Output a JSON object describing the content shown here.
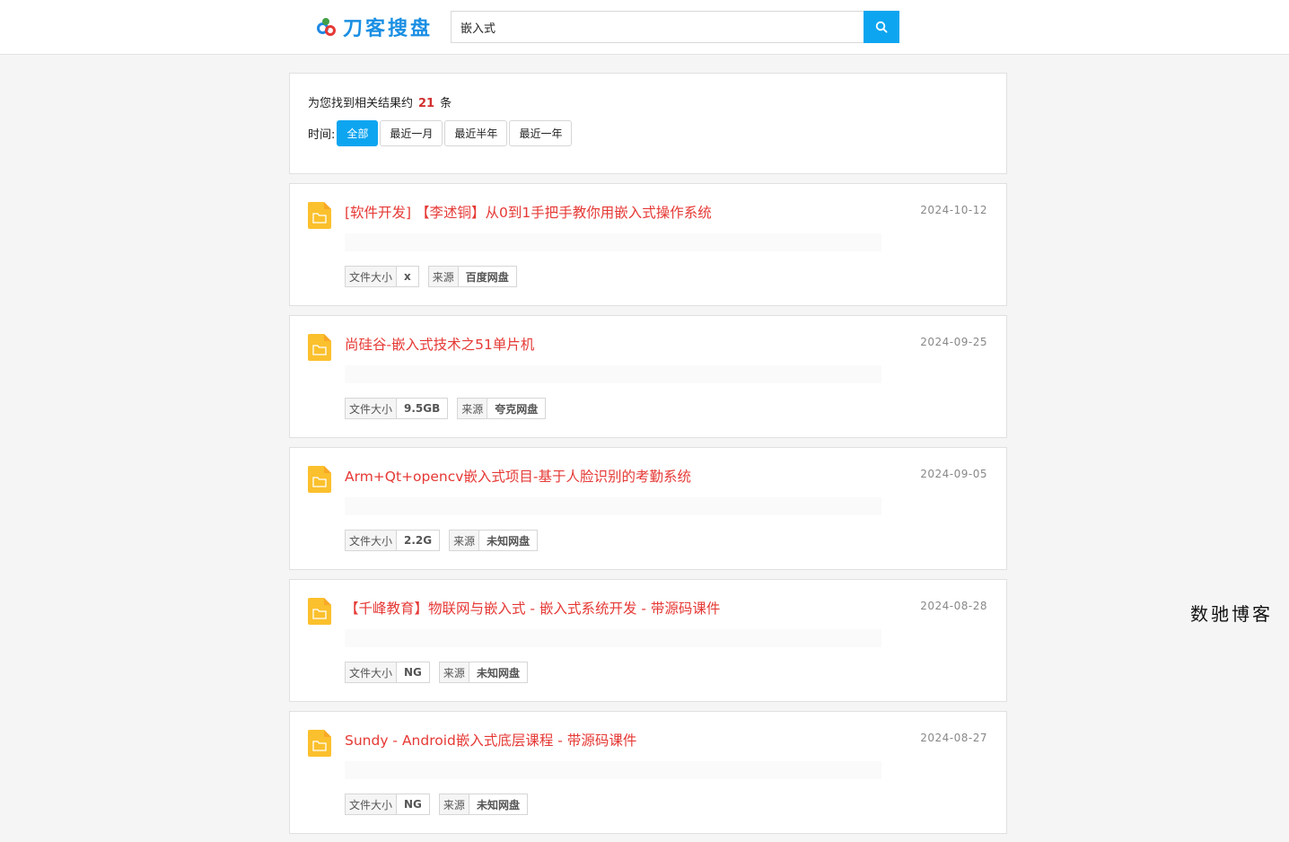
{
  "brand": {
    "name": "刀客搜盘"
  },
  "search": {
    "value": "嵌入式"
  },
  "summary": {
    "prefix": "为您找到相关结果约",
    "count": "21",
    "suffix": "条"
  },
  "time_filter": {
    "label": "时间:",
    "options": [
      "全部",
      "最近一月",
      "最近半年",
      "最近一年"
    ],
    "selected": "全部"
  },
  "colors": {
    "accent": "#0ea5f0",
    "title": "#e53935",
    "folder": "#fbc02d"
  },
  "results": [
    {
      "title": "[软件开发] 【李述铜】从0到1手把手教你用嵌入式操作系统",
      "date": "2024-10-12",
      "size_label": "文件大小",
      "size": "x",
      "source_label": "来源",
      "source": "百度网盘"
    },
    {
      "title": "尚硅谷-嵌入式技术之51单片机",
      "date": "2024-09-25",
      "size_label": "文件大小",
      "size": "9.5GB",
      "source_label": "来源",
      "source": "夸克网盘"
    },
    {
      "title": "Arm+Qt+opencv嵌入式项目-基于人脸识别的考勤系统",
      "date": "2024-09-05",
      "size_label": "文件大小",
      "size": "2.2G",
      "source_label": "来源",
      "source": "未知网盘"
    },
    {
      "title": "【千峰教育】物联网与嵌入式 - 嵌入式系统开发 - 带源码课件",
      "date": "2024-08-28",
      "size_label": "文件大小",
      "size": "NG",
      "source_label": "来源",
      "source": "未知网盘"
    },
    {
      "title": "Sundy - Android嵌入式底层课程 - 带源码课件",
      "date": "2024-08-27",
      "size_label": "文件大小",
      "size": "NG",
      "source_label": "来源",
      "source": "未知网盘"
    }
  ],
  "watermark": "数驰博客"
}
